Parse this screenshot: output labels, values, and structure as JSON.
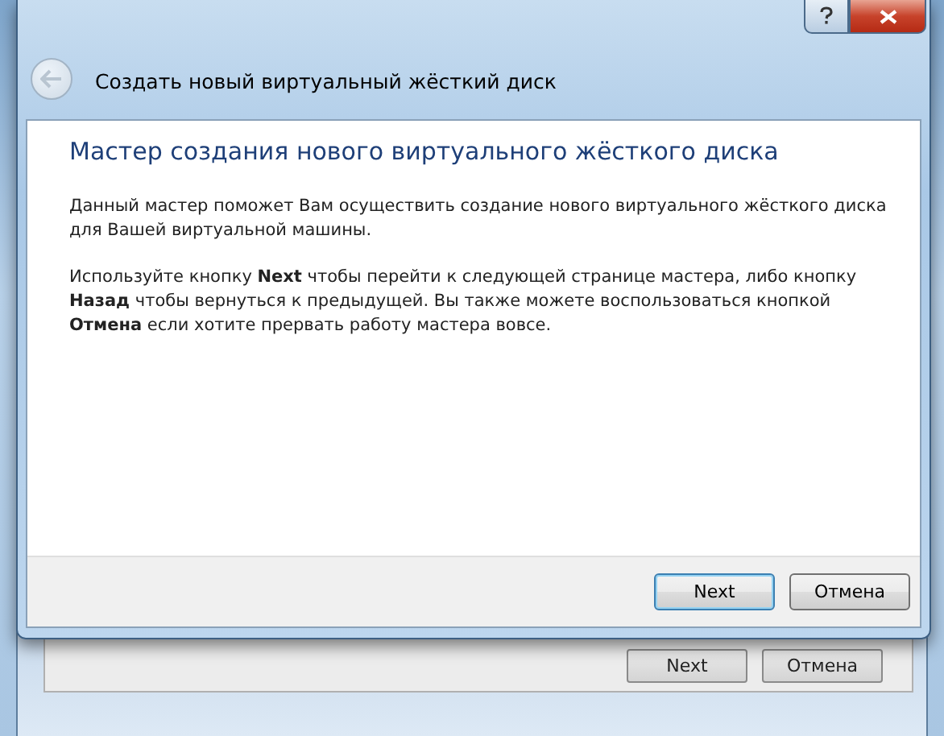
{
  "dialog": {
    "title": "Создать новый виртуальный жёсткий диск",
    "back_button": {
      "disabled": true
    },
    "heading": "Мастер создания нового виртуального жёсткого диска",
    "paragraphs": [
      "Данный мастер поможет Вам осуществить создание нового виртуального жёсткого диска для Вашей виртуальной машины.",
      "Используйте кнопку **Next** чтобы перейти к следующей странице мастера, либо кнопку **Назад** чтобы вернуться к предыдущей. Вы также можете воспользоваться кнопкой **Отмена** если хотите прервать работу мастера вовсе."
    ],
    "buttons": [
      {
        "label": "Next",
        "focused": true
      },
      {
        "label": "Отмена",
        "focused": false
      }
    ]
  },
  "background_window": {
    "buttons": [
      {
        "label": "Next"
      },
      {
        "label": "Отмена"
      }
    ]
  }
}
